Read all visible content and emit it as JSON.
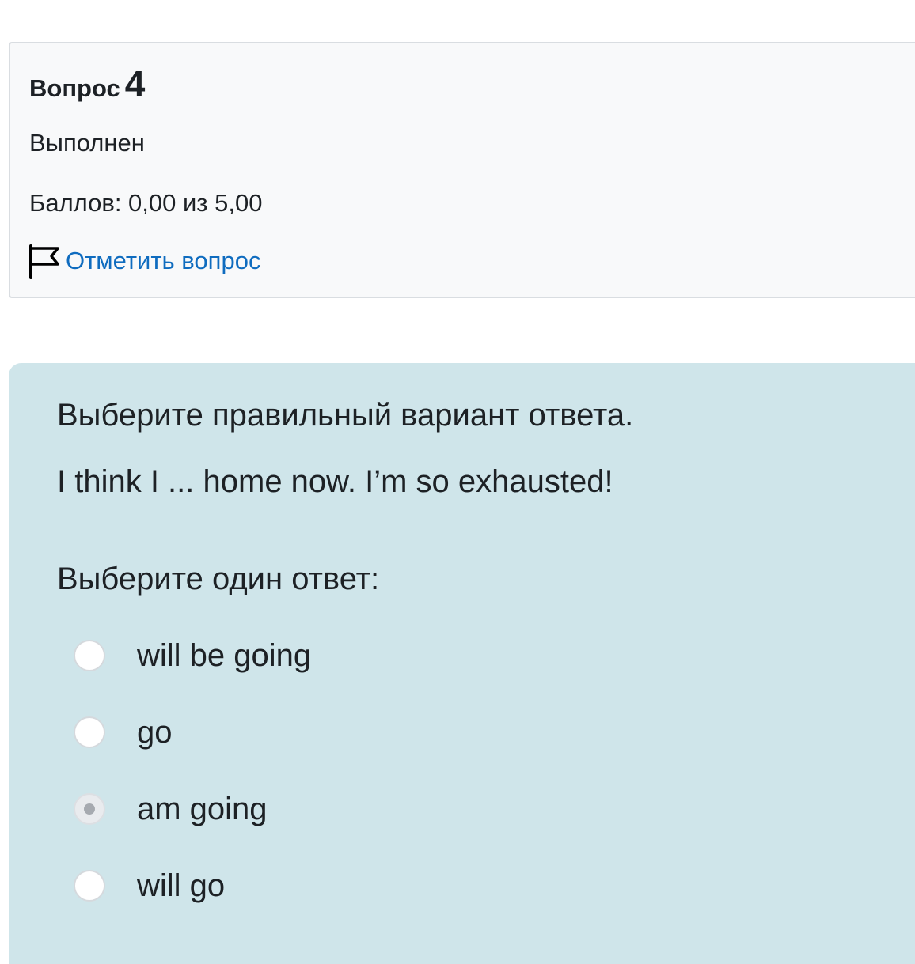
{
  "info": {
    "question_word": "Вопрос",
    "question_number": "4",
    "state": "Выполнен",
    "grade": "Баллов: 0,00 из 5,00",
    "flag_label": "Отметить вопрос"
  },
  "content": {
    "instruction": "Выберите правильный вариант ответа.",
    "question_text": "I think I ... home now. I’m so exhausted!",
    "prompt": "Выберите один ответ:",
    "options": [
      {
        "label": "will be going",
        "selected": false
      },
      {
        "label": "go",
        "selected": false
      },
      {
        "label": "am going",
        "selected": true
      },
      {
        "label": "will go",
        "selected": false
      }
    ]
  },
  "colors": {
    "info_background": "#f8f9fa",
    "content_background": "#cfe5ea",
    "link": "#0f6cbf",
    "text": "#1d2125"
  },
  "icons": {
    "flag": "flag-icon"
  }
}
